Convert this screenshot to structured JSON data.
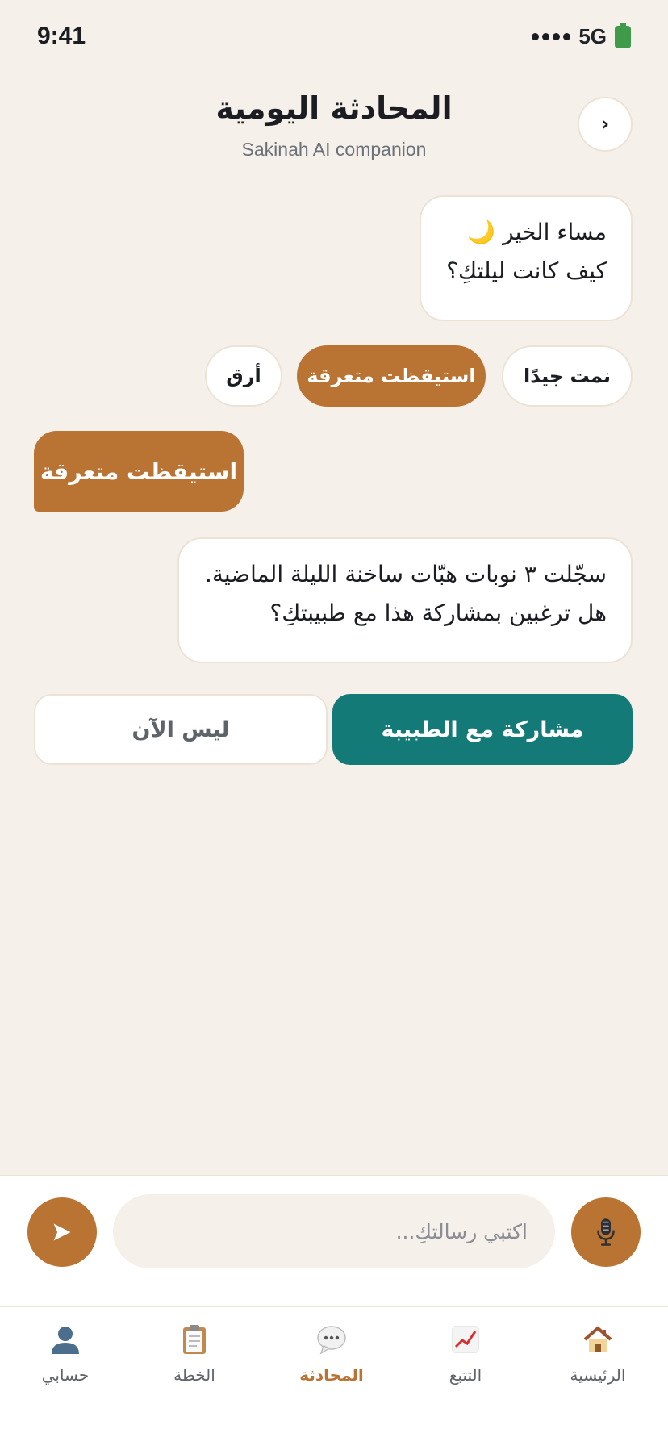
{
  "status_bar": {
    "time": "9:41",
    "network": "5G",
    "icons": [
      "signal-dots-icon",
      "battery-icon"
    ]
  },
  "header": {
    "title": "المحادثة اليومية",
    "subtitle": "Sakinah AI companion",
    "back_label": "›"
  },
  "chat": {
    "greeting_line1": "مساء الخير 🌙",
    "greeting_line2": "كيف كانت ليلتكِ؟",
    "quick_replies": [
      "نمت جيدًا",
      "استيقظت متعرقة",
      "أرق"
    ],
    "selected_reply": "استيقظت متعرقة",
    "user_message": "استيقظت متعرقة",
    "bot_line1": "سجّلت ٣ نوبات هبّات ساخنة الليلة الماضية.",
    "bot_line2": "هل ترغبين بمشاركة هذا مع طبيبتكِ؟",
    "share_label": "مشاركة مع الطبيبة",
    "not_now_label": "ليس الآن"
  },
  "composer": {
    "placeholder": "اكتبي رسالتكِ...",
    "value": "",
    "send_icon": "send-icon",
    "mic_icon": "microphone-icon"
  },
  "tabs": [
    {
      "label": "الرئيسية",
      "icon": "house-icon",
      "active": false
    },
    {
      "label": "التتبع",
      "icon": "chart-trend-icon",
      "active": false
    },
    {
      "label": "المحادثة",
      "icon": "chat-bubble-icon",
      "active": true
    },
    {
      "label": "الخطة",
      "icon": "clipboard-icon",
      "active": false
    },
    {
      "label": "حسابي",
      "icon": "user-icon",
      "active": false
    }
  ],
  "colors": {
    "background": "#f5f0ea",
    "accent": "#b97333",
    "teal": "#147a78",
    "card": "#ffffff",
    "border": "#ece3d6"
  }
}
